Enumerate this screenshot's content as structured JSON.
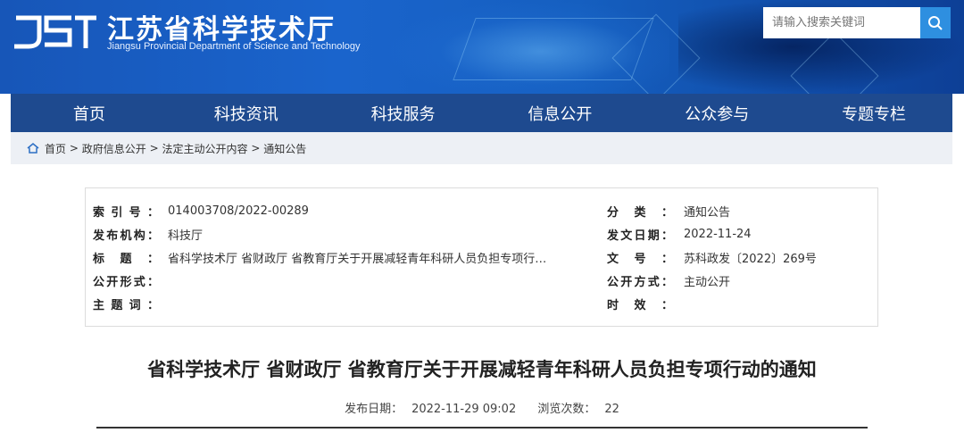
{
  "header": {
    "logo_text": "JST",
    "title": "江苏省科学技术厅",
    "subtitle": "Jiangsu Provincial Department of Science and Technology",
    "search_placeholder": "请输入搜索关键词"
  },
  "nav": {
    "items": [
      "首页",
      "科技资讯",
      "科技服务",
      "信息公开",
      "公众参与",
      "专题专栏"
    ]
  },
  "breadcrumb": {
    "items": [
      "首页",
      "政府信息公开",
      "法定主动公开内容",
      "通知公告"
    ],
    "separator": ">"
  },
  "meta": {
    "left": [
      {
        "label": [
          "索",
          "引",
          "号"
        ],
        "value": "014003708/2022-00289"
      },
      {
        "label": [
          "发",
          "布",
          "机",
          "构"
        ],
        "value": "科技厅"
      },
      {
        "label": [
          "标",
          "题"
        ],
        "value": "省科学技术厅 省财政厅 省教育厅关于开展减轻青年科研人员负担专项行…"
      },
      {
        "label": [
          "公",
          "开",
          "形",
          "式"
        ],
        "value": ""
      },
      {
        "label": [
          "主",
          "题",
          "词"
        ],
        "value": ""
      }
    ],
    "right": [
      {
        "label": [
          "分",
          "类"
        ],
        "value": "通知公告"
      },
      {
        "label": [
          "发",
          "文",
          "日",
          "期"
        ],
        "value": "2022-11-24"
      },
      {
        "label": [
          "文",
          "号"
        ],
        "value": "苏科政发〔2022〕269号"
      },
      {
        "label": [
          "公",
          "开",
          "方",
          "式"
        ],
        "value": "主动公开"
      },
      {
        "label": [
          "时",
          "效"
        ],
        "value": ""
      }
    ]
  },
  "article": {
    "title": "省科学技术厅 省财政厅 省教育厅关于开展减轻青年科研人员负担专项行动的通知",
    "publish_label": "发布日期：",
    "publish_date": "2022-11-29 09:02",
    "views_label": "浏览次数：",
    "views": "22"
  },
  "colors": {
    "nav_bg": "#1e4a8f",
    "banner": "#1a64cc",
    "search_button": "#2e8fe0",
    "breadcrumb_bg": "#edf0f5"
  }
}
